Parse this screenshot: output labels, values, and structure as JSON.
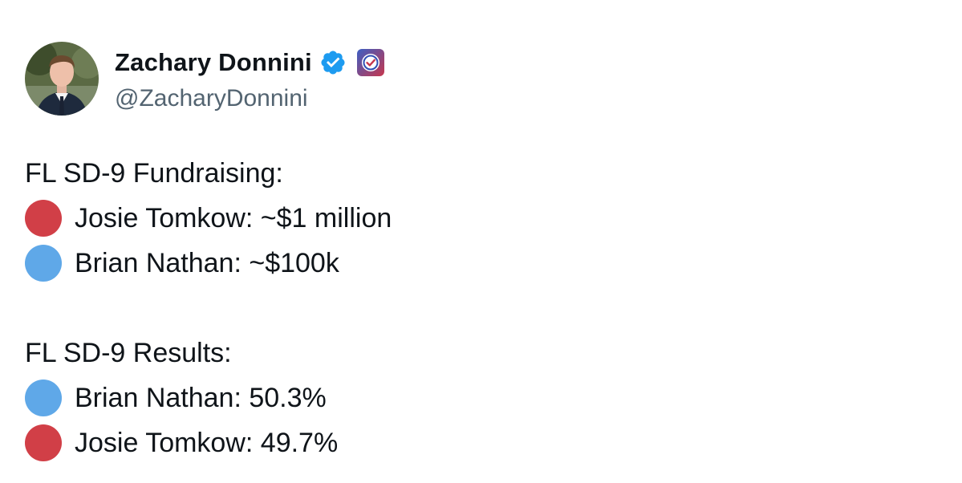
{
  "author": {
    "display_name": "Zachary Donnini",
    "handle": "@ZacharyDonnini",
    "badges": [
      "verified-check-icon",
      "affiliate-badge-icon"
    ],
    "verified_color": "#1d9bf0"
  },
  "colors": {
    "red_dot": "#d13f47",
    "blue_dot": "#5fa8e8"
  },
  "post": {
    "fundraising": {
      "heading": "FL SD-9 Fundraising:",
      "items": [
        {
          "icon": "red-circle-icon",
          "text": "Josie Tomkow: ~$1 million"
        },
        {
          "icon": "blue-circle-icon",
          "text": "Brian Nathan: ~$100k"
        }
      ]
    },
    "results": {
      "heading": "FL SD-9 Results:",
      "items": [
        {
          "icon": "blue-circle-icon",
          "text": "Brian Nathan: 50.3%"
        },
        {
          "icon": "red-circle-icon",
          "text": "Josie Tomkow: 49.7%"
        }
      ]
    }
  }
}
